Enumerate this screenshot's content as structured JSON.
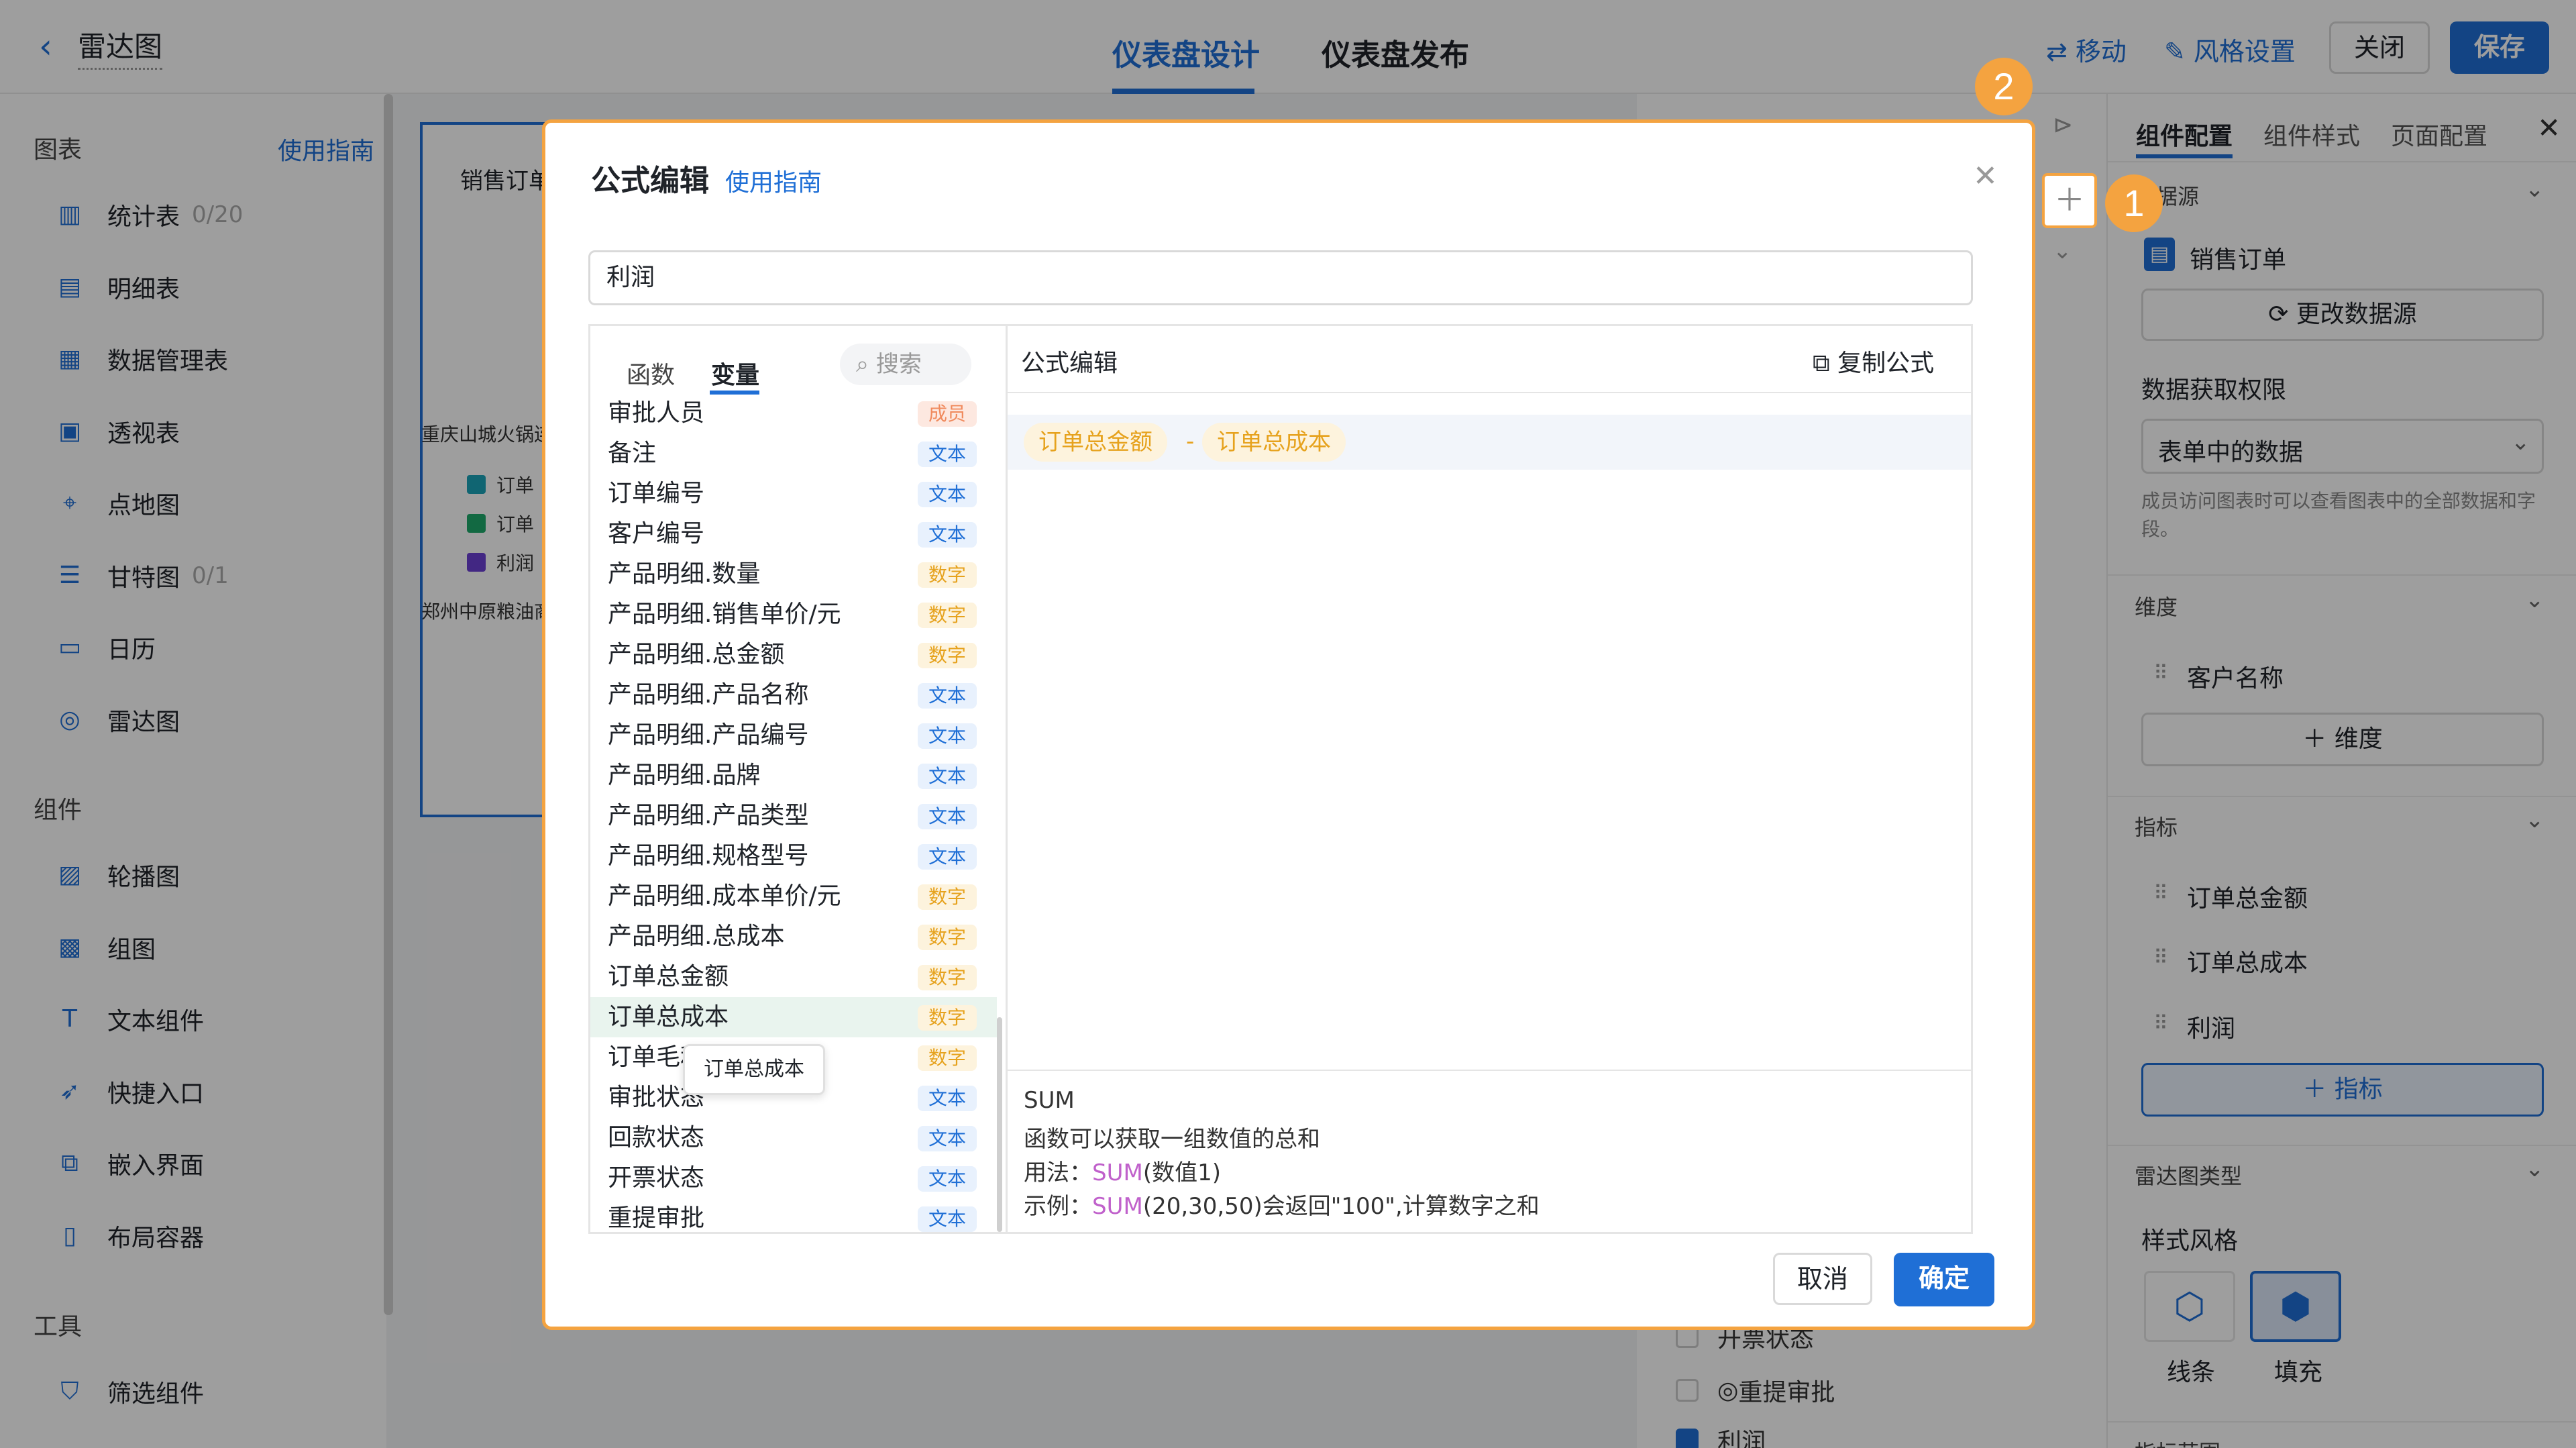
{
  "header": {
    "back_icon": "chevron-left-icon",
    "title": "雷达图",
    "tabs": [
      "仪表盘设计",
      "仪表盘发布"
    ],
    "move": "移动",
    "style_settings": "风格设置",
    "close": "关闭",
    "save": "保存"
  },
  "left": {
    "charts_heading": "图表",
    "guide": "使用指南",
    "charts": [
      {
        "icon": "bar-chart-icon",
        "label": "统计表",
        "count": "0/20"
      },
      {
        "icon": "table-icon",
        "label": "明细表",
        "count": ""
      },
      {
        "icon": "data-table-icon",
        "label": "数据管理表",
        "count": ""
      },
      {
        "icon": "pivot-icon",
        "label": "透视表",
        "count": ""
      },
      {
        "icon": "map-pin-icon",
        "label": "点地图",
        "count": ""
      },
      {
        "icon": "gantt-icon",
        "label": "甘特图",
        "count": "0/1"
      },
      {
        "icon": "calendar-icon",
        "label": "日历",
        "count": ""
      },
      {
        "icon": "radar-icon",
        "label": "雷达图",
        "count": ""
      }
    ],
    "components_heading": "组件",
    "components": [
      {
        "icon": "carousel-icon",
        "label": "轮播图"
      },
      {
        "icon": "image-group-icon",
        "label": "组图"
      },
      {
        "icon": "text-icon",
        "label": "文本组件"
      },
      {
        "icon": "rocket-icon",
        "label": "快捷入口"
      },
      {
        "icon": "embed-icon",
        "label": "嵌入界面"
      },
      {
        "icon": "layout-icon",
        "label": "布局容器"
      }
    ],
    "tools_heading": "工具",
    "tools": [
      {
        "icon": "filter-icon",
        "label": "筛选组件"
      }
    ]
  },
  "canvas": {
    "card_title": "销售订单",
    "label1": "重庆山城火锅连",
    "legend": [
      {
        "label": "订单",
        "color": "#1aa3b8"
      },
      {
        "label": "订单",
        "color": "#1eaa6b"
      },
      {
        "label": "利润",
        "color": "#6b3fd4"
      }
    ],
    "label2": "郑州中原粮油商"
  },
  "right_bar": {
    "fields": [
      "开票状态",
      "重提审批",
      "利润"
    ]
  },
  "sidebar": {
    "tabs": [
      "组件配置",
      "组件样式",
      "页面配置"
    ],
    "datasource_heading": "数据源",
    "datasource_name": "销售订单",
    "change_source": "更改数据源",
    "permission_heading": "数据获取权限",
    "permission_value": "表单中的数据",
    "permission_hint": "成员访问图表时可以查看图表中的全部数据和字段。",
    "dimension_heading": "维度",
    "dimension_field": "客户名称",
    "add_dimension": "维度",
    "metric_heading": "指标",
    "metrics": [
      "订单总金额",
      "订单总成本",
      "利润"
    ],
    "add_metric": "指标",
    "radar_type_heading": "雷达图类型",
    "style_heading": "样式风格",
    "styles": [
      "线条",
      "填充"
    ],
    "metric_range_heading": "指标范围"
  },
  "dialog": {
    "title": "公式编辑",
    "guide": "使用指南",
    "field_name": "利润",
    "tab_functions": "函数",
    "tab_variables": "变量",
    "search_placeholder": "搜索",
    "editor_heading": "公式编辑",
    "copy_formula": "复制公式",
    "formula_tokens": [
      "订单总金额",
      "订单总成本"
    ],
    "formula_operator": "-",
    "variables": [
      {
        "name": "审批人员",
        "type": "成员",
        "kind": "mem"
      },
      {
        "name": "备注",
        "type": "文本",
        "kind": "txt"
      },
      {
        "name": "订单编号",
        "type": "文本",
        "kind": "txt"
      },
      {
        "name": "客户编号",
        "type": "文本",
        "kind": "txt"
      },
      {
        "name": "产品明细.数量",
        "type": "数字",
        "kind": "num"
      },
      {
        "name": "产品明细.销售单价/元",
        "type": "数字",
        "kind": "num"
      },
      {
        "name": "产品明细.总金额",
        "type": "数字",
        "kind": "num"
      },
      {
        "name": "产品明细.产品名称",
        "type": "文本",
        "kind": "txt"
      },
      {
        "name": "产品明细.产品编号",
        "type": "文本",
        "kind": "txt"
      },
      {
        "name": "产品明细.品牌",
        "type": "文本",
        "kind": "txt"
      },
      {
        "name": "产品明细.产品类型",
        "type": "文本",
        "kind": "txt"
      },
      {
        "name": "产品明细.规格型号",
        "type": "文本",
        "kind": "txt"
      },
      {
        "name": "产品明细.成本单价/元",
        "type": "数字",
        "kind": "num"
      },
      {
        "name": "产品明细.总成本",
        "type": "数字",
        "kind": "num"
      },
      {
        "name": "订单总金额",
        "type": "数字",
        "kind": "num"
      },
      {
        "name": "订单总成本",
        "type": "数字",
        "kind": "num"
      },
      {
        "name": "订单毛利率",
        "type": "数字",
        "kind": "num"
      },
      {
        "name": "审批状态",
        "type": "文本",
        "kind": "txt"
      },
      {
        "name": "回款状态",
        "type": "文本",
        "kind": "txt"
      },
      {
        "name": "开票状态",
        "type": "文本",
        "kind": "txt"
      },
      {
        "name": "重提审批",
        "type": "文本",
        "kind": "txt"
      }
    ],
    "tooltip": "订单总成本",
    "doc_name": "SUM",
    "doc_desc": "函数可以获取一组数值的总和",
    "doc_usage_label": "用法：",
    "doc_usage_fn": "SUM",
    "doc_usage_args": "(数值1)",
    "doc_example_label": "示例：",
    "doc_example_fn": "SUM",
    "doc_example_rest": "(20,30,50)会返回\"100\",计算数字之和",
    "cancel": "取消",
    "ok": "确定"
  },
  "callouts": [
    "1",
    "2"
  ],
  "colors": {
    "accent": "#1f6fd6",
    "highlight": "#f4a340"
  }
}
